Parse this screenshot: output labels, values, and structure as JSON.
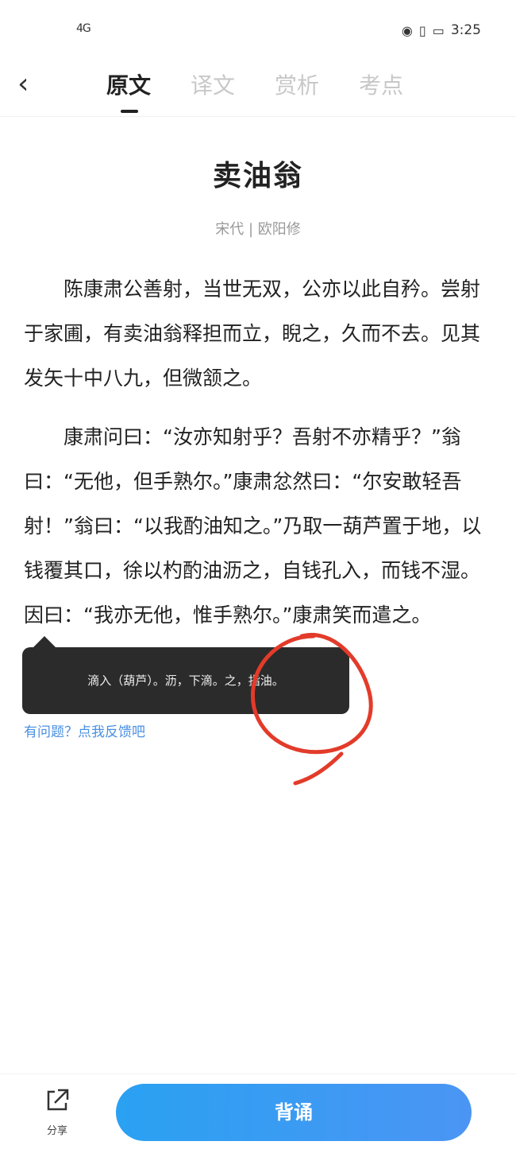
{
  "status_bar": {
    "signal": "4G",
    "time": "3:25"
  },
  "nav": {
    "tabs": [
      {
        "label": "原文",
        "active": true
      },
      {
        "label": "译文",
        "active": false
      },
      {
        "label": "赏析",
        "active": false
      },
      {
        "label": "考点",
        "active": false
      }
    ]
  },
  "poem": {
    "title": "卖油翁",
    "byline": "宋代 | 欧阳修",
    "paragraphs": [
      "陈康肃公善射，当世无双，公亦以此自矜。尝射于家圃，有卖油翁释担而立，睨之，久而不去。见其发矢十中八九，但微颔之。",
      "康肃问曰：“汝亦知射乎？吾射不亦精乎？”翁曰：“无他，但手熟尔。”康肃忿然曰：“尔安敢轻吾射！”翁曰：“以我酌油知之。”乃取一葫芦置于地，以钱覆其口，徐以杓酌油沥之，自钱孔入，而钱不湿。因曰：“我亦无他，惟手熟尔。”康肃笑而遣之。"
    ]
  },
  "tooltip": {
    "text": "滴入（葫芦）。沥，下滴。之，指油。"
  },
  "feedback": {
    "label": "有问题？点我反馈吧"
  },
  "bottom_bar": {
    "share_label": "分享",
    "recite_label": "背诵"
  },
  "colors": {
    "accent": "#3a9cf3",
    "link": "#4a90e2",
    "annotation": "#e33b2a"
  }
}
